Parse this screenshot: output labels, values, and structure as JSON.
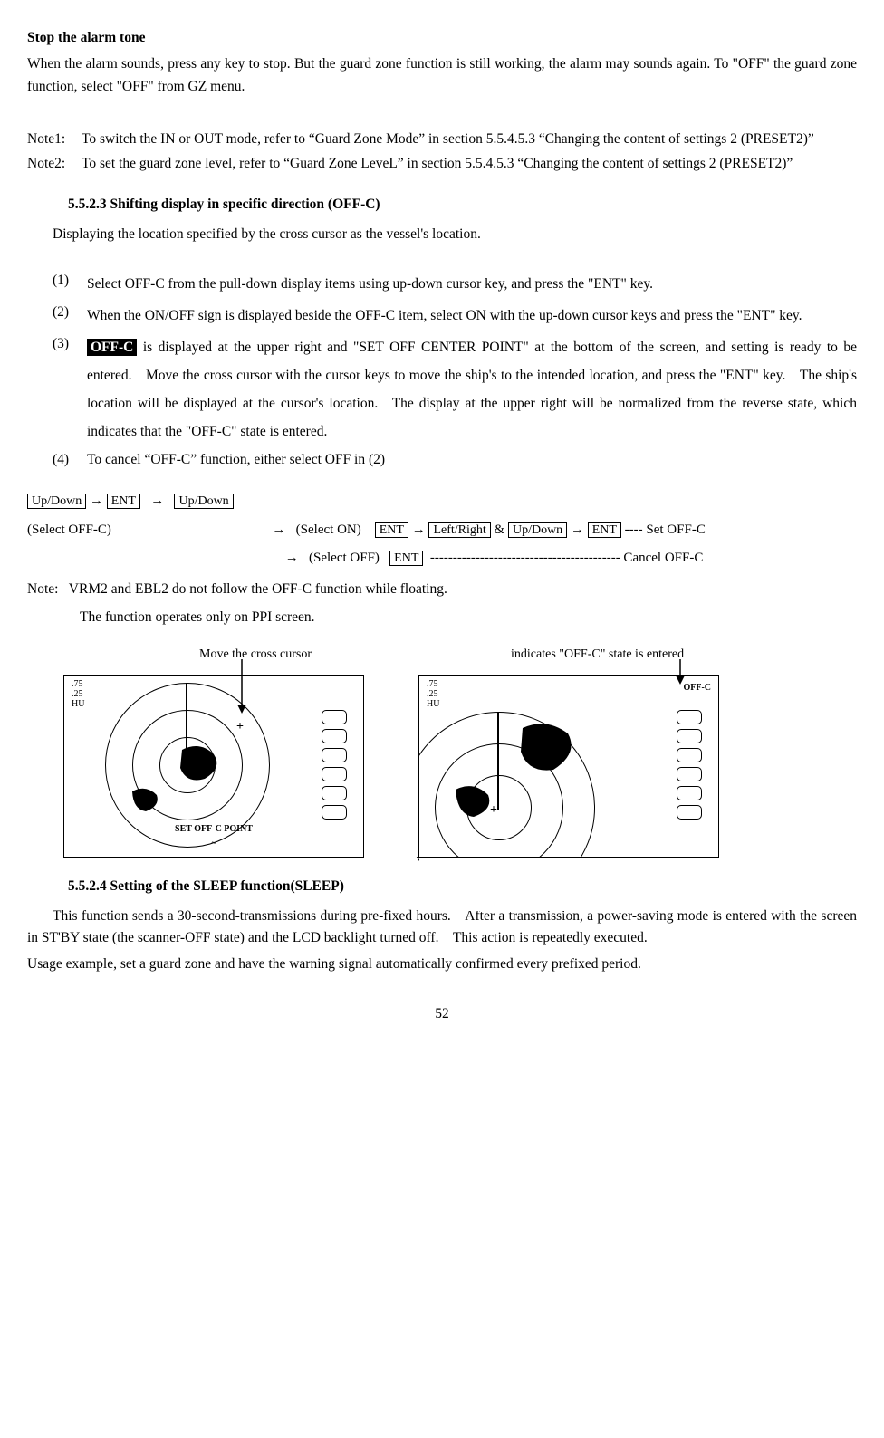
{
  "heading_stop_alarm": "Stop the alarm tone",
  "stop_alarm_text": "When the alarm sounds, press any key to stop. But the guard zone function is still working, the alarm may sounds again. To \"OFF\" the guard zone function, select \"OFF\" from GZ menu.",
  "note1_label": "Note1:",
  "note1_text": "To switch the IN or OUT mode, refer to “Guard Zone Mode” in section 5.5.4.5.3 “Changing the content of settings 2 (PRESET2)”",
  "note2_label": "Note2:",
  "note2_text": "To set the guard zone level, refer to “Guard Zone LeveL” in section 5.5.4.5.3 “Changing the content of settings 2 (PRESET2)”",
  "sec_5523_title": "5.5.2.3 Shifting display in specific direction (OFF-C)",
  "sec_5523_intro": "Displaying the location specified by the cross cursor as the vessel's location.",
  "items": {
    "i1_num": "(1)",
    "i1_txt": "Select OFF-C from the pull-down display items using up-down cursor key, and press the \"ENT\" key.",
    "i2_num": "(2)",
    "i2_txt": "When the ON/OFF sign is displayed beside the OFF-C item, select ON with the up-down cursor keys and press the \"ENT\" key.",
    "i3_num": "(3)",
    "i3_badge": "OFF-C",
    "i3_txt": " is displayed at the upper right and \"SET OFF CENTER POINT\" at the bottom of the screen, and setting is ready to be entered. Move the cross cursor with the cursor keys to move the ship's to the intended location, and press the \"ENT\" key. The ship's location will be displayed at the cursor's location. The display at the upper right will be normalized from the reverse state, which indicates that the \"OFF-C\" state is entered.",
    "i4_num": "(4)",
    "i4_txt": "To cancel “OFF-C” function, either select OFF in (2)"
  },
  "keys": {
    "updown": "Up/Down",
    "ent": "ENT",
    "leftright": "Left/Right",
    "arrow": "→",
    "amp": "&",
    "select_offc": "(Select OFF-C)",
    "select_on": "(Select ON)",
    "select_off": "(Select OFF)",
    "set_offc": "---- Set OFF-C",
    "cancel_offc": "------------------------------------------ Cancel OFF-C"
  },
  "note_followup_lbl": "Note:",
  "note_followup_1": "VRM2 and EBL2 do not follow the OFF-C function while floating.",
  "note_followup_2": "The function operates only on PPI screen.",
  "dlabel_left": "Move the cross cursor",
  "dlabel_right": "indicates \"OFF-C\" state is entered",
  "radar": {
    "range": ".75",
    "rings": ".25",
    "mode": "HU",
    "set_point": "SET OFF-C POINT",
    "tilde": "~",
    "offc": "OFF-C"
  },
  "sec_5524_title": "5.5.2.4 Setting of the SLEEP function(SLEEP)",
  "sec_5524_p1": "This function sends a 30-second-transmissions during pre-fixed hours. After a transmission, a power-saving mode is entered with the screen in ST'BY state (the scanner-OFF state) and the LCD backlight turned off. This action is repeatedly executed.",
  "sec_5524_p2": "Usage example, set a guard zone and have the warning signal automatically confirmed every prefixed period.",
  "page_number": "52"
}
